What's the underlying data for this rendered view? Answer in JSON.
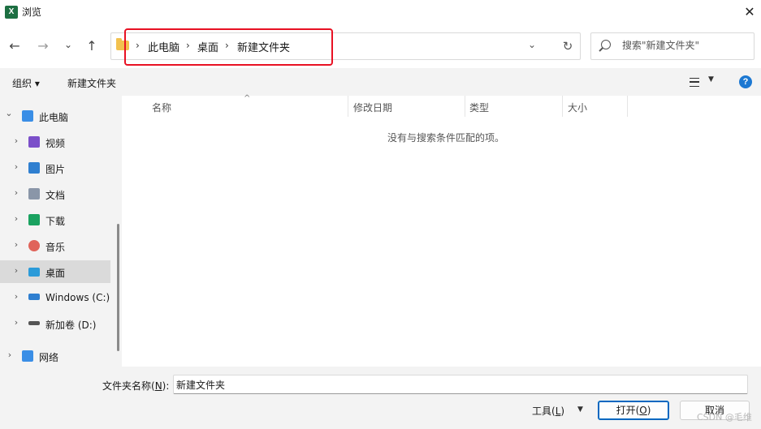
{
  "window": {
    "title": "浏览",
    "app_icon_letter": "X",
    "close_glyph": "✕"
  },
  "nav": {
    "back_glyph": "←",
    "forward_glyph": "→",
    "recent_glyph": "⌄",
    "up_glyph": "↑"
  },
  "address": {
    "breadcrumbs": [
      "此电脑",
      "桌面",
      "新建文件夹"
    ],
    "separator": "›",
    "dropdown_glyph": "⌄",
    "refresh_glyph": "↻"
  },
  "search": {
    "placeholder": "搜索\"新建文件夹\""
  },
  "toolbar": {
    "organize_label": "组织 ▾",
    "new_folder_label": "新建文件夹",
    "view_drop_glyph": "▼",
    "help_glyph": "?"
  },
  "tree": {
    "items": [
      {
        "label": "此电脑",
        "icon": "computer-icon",
        "color": "#3a8ee6",
        "expanded": true
      },
      {
        "label": "视频",
        "icon": "video-icon",
        "color": "#7b4fc9"
      },
      {
        "label": "图片",
        "icon": "pictures-icon",
        "color": "#2f7fd0"
      },
      {
        "label": "文档",
        "icon": "documents-icon",
        "color": "#8a96a8"
      },
      {
        "label": "下载",
        "icon": "download-icon",
        "color": "#1aa260"
      },
      {
        "label": "音乐",
        "icon": "music-icon",
        "color": "#e0645a"
      },
      {
        "label": "桌面",
        "icon": "desktop-icon",
        "color": "#2b9bd9",
        "selected": true
      },
      {
        "label": "Windows  (C:)",
        "icon": "windows-drive-icon",
        "color": "#2f7fd0"
      },
      {
        "label": "新加卷 (D:)",
        "icon": "drive-icon",
        "color": "#555555"
      },
      {
        "label": "网络",
        "icon": "network-icon",
        "color": "#3a8ee6"
      }
    ],
    "expand_glyph": "›",
    "collapse_glyph": "⌄"
  },
  "columns": [
    "名称",
    "修改日期",
    "类型",
    "大小"
  ],
  "sort_caret": "^",
  "empty_message": "没有与搜索条件匹配的项。",
  "footer": {
    "filename_label": "文件夹名称(",
    "filename_key": "N",
    "filename_label_end": "):",
    "filename_value": "新建文件夹",
    "tools_label": "工具(",
    "tools_key": "L",
    "tools_label_end": ")",
    "tools_drop_glyph": "▼",
    "open_label": "打开(",
    "open_key": "O",
    "open_label_end": ")",
    "cancel_label": "取消"
  },
  "watermark": "CSDN @毛维"
}
